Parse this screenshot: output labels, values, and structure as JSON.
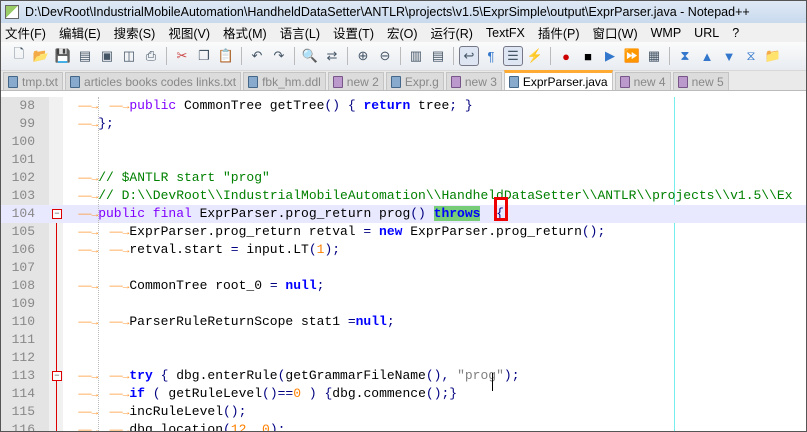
{
  "window": {
    "title": "D:\\DevRoot\\IndustrialMobileAutomation\\HandheldDataSetter\\ANTLR\\projects\\v1.5\\ExprSimple\\output\\ExprParser.java - Notepad++"
  },
  "menu": [
    "文件(F)",
    "编辑(E)",
    "搜索(S)",
    "视图(V)",
    "格式(M)",
    "语言(L)",
    "设置(T)",
    "宏(O)",
    "运行(R)",
    "TextFX",
    "插件(P)",
    "窗口(W)",
    "WMP",
    "URL",
    "?"
  ],
  "toolbar": [
    "new",
    "open",
    "save",
    "save-all",
    "close",
    "close-all",
    "print",
    "|",
    "cut",
    "copy",
    "paste",
    "|",
    "undo",
    "redo",
    "|",
    "find",
    "replace",
    "|",
    "zoom-in",
    "zoom-out",
    "|",
    "sync-v",
    "sync-h",
    "|",
    "word-wrap",
    "show-all",
    "indent-guide",
    "user-lang",
    "|",
    "record",
    "stop",
    "play",
    "play-multi",
    "save-macro",
    "|",
    "fold-all",
    "up",
    "down",
    "unfold-all",
    "open-folder"
  ],
  "tabs": [
    {
      "label": "tmp.txt",
      "kind": "saved"
    },
    {
      "label": "articles books codes links.txt",
      "kind": "saved"
    },
    {
      "label": "fbk_hm.ddl",
      "kind": "saved"
    },
    {
      "label": "new  2",
      "kind": "new"
    },
    {
      "label": "Expr.g",
      "kind": "saved"
    },
    {
      "label": "new  3",
      "kind": "new"
    },
    {
      "label": "ExprParser.java",
      "kind": "saved",
      "active": true
    },
    {
      "label": "new  4",
      "kind": "new"
    },
    {
      "label": "new  5",
      "kind": "new"
    }
  ],
  "lines": [
    {
      "num": "98",
      "tokens": [
        [
          "tab",
          ""
        ],
        [
          "tab",
          ""
        ],
        [
          "kw",
          "public"
        ],
        [
          "df",
          " CommonTree getTree"
        ],
        [
          "op",
          "() { "
        ],
        [
          "kb",
          "return"
        ],
        [
          "df",
          " tree"
        ],
        [
          "op",
          "; }"
        ]
      ]
    },
    {
      "num": "99",
      "tokens": [
        [
          "tab",
          ""
        ],
        [
          "op",
          "};"
        ]
      ]
    },
    {
      "num": "100",
      "tokens": []
    },
    {
      "num": "101",
      "tokens": []
    },
    {
      "num": "102",
      "tokens": [
        [
          "tab",
          ""
        ],
        [
          "cm",
          "// $ANTLR start \"prog\""
        ]
      ]
    },
    {
      "num": "103",
      "tokens": [
        [
          "tab",
          ""
        ],
        [
          "cm",
          "// D:\\\\DevRoot\\\\IndustrialMobileAutomation\\\\HandheldDataSetter\\\\ANTLR\\\\projects\\\\v1.5\\\\Ex"
        ]
      ]
    },
    {
      "num": "104",
      "fold": true,
      "current": true,
      "tokens": [
        [
          "tab",
          ""
        ],
        [
          "kw",
          "public final"
        ],
        [
          "df",
          " ExprParser.prog_return prog"
        ],
        [
          "op",
          "() "
        ],
        [
          "hl",
          "throws"
        ],
        [
          "df",
          "  "
        ],
        [
          "op",
          "{"
        ]
      ]
    },
    {
      "num": "105",
      "tokens": [
        [
          "tab",
          ""
        ],
        [
          "tab",
          ""
        ],
        [
          "df",
          "ExprParser.prog_return retval "
        ],
        [
          "op",
          "= "
        ],
        [
          "kb",
          "new"
        ],
        [
          "df",
          " ExprParser.prog_return"
        ],
        [
          "op",
          "();"
        ]
      ]
    },
    {
      "num": "106",
      "tokens": [
        [
          "tab",
          ""
        ],
        [
          "tab",
          ""
        ],
        [
          "df",
          "retval.start "
        ],
        [
          "op",
          "= "
        ],
        [
          "df",
          "input.LT"
        ],
        [
          "op",
          "("
        ],
        [
          "nm",
          "1"
        ],
        [
          "op",
          ");"
        ]
      ]
    },
    {
      "num": "107",
      "tokens": []
    },
    {
      "num": "108",
      "tokens": [
        [
          "tab",
          ""
        ],
        [
          "tab",
          ""
        ],
        [
          "df",
          "CommonTree root_0 "
        ],
        [
          "op",
          "= "
        ],
        [
          "kb",
          "null"
        ],
        [
          "op",
          ";"
        ]
      ]
    },
    {
      "num": "109",
      "tokens": []
    },
    {
      "num": "110",
      "tokens": [
        [
          "tab",
          ""
        ],
        [
          "tab",
          ""
        ],
        [
          "df",
          "ParserRuleReturnScope stat1 "
        ],
        [
          "op",
          "="
        ],
        [
          "kb",
          "null"
        ],
        [
          "op",
          ";"
        ]
      ]
    },
    {
      "num": "111",
      "tokens": []
    },
    {
      "num": "112",
      "tokens": []
    },
    {
      "num": "113",
      "fold": true,
      "tokens": [
        [
          "tab",
          ""
        ],
        [
          "tab",
          ""
        ],
        [
          "kb",
          "try"
        ],
        [
          "op",
          " { "
        ],
        [
          "df",
          "dbg.enterRule"
        ],
        [
          "op",
          "("
        ],
        [
          "df",
          "getGrammarFileName"
        ],
        [
          "op",
          "(), "
        ],
        [
          "st",
          "\"prog\""
        ],
        [
          "op",
          ");"
        ]
      ]
    },
    {
      "num": "114",
      "tokens": [
        [
          "tab",
          ""
        ],
        [
          "tab",
          ""
        ],
        [
          "kb",
          "if"
        ],
        [
          "op",
          " ( "
        ],
        [
          "df",
          "getRuleLevel"
        ],
        [
          "op",
          "()=="
        ],
        [
          "nm",
          "0"
        ],
        [
          "op",
          " ) {"
        ],
        [
          "df",
          "dbg.commence"
        ],
        [
          "op",
          "();}"
        ]
      ]
    },
    {
      "num": "115",
      "tokens": [
        [
          "tab",
          ""
        ],
        [
          "tab",
          ""
        ],
        [
          "df",
          "incRuleLevel"
        ],
        [
          "op",
          "();"
        ]
      ]
    },
    {
      "num": "116",
      "tokens": [
        [
          "tab",
          ""
        ],
        [
          "tab",
          ""
        ],
        [
          "df",
          "dbg.location"
        ],
        [
          "op",
          "("
        ],
        [
          "nm",
          "12"
        ],
        [
          "op",
          ", "
        ],
        [
          "nm",
          "0"
        ],
        [
          "op",
          ");"
        ]
      ]
    }
  ]
}
